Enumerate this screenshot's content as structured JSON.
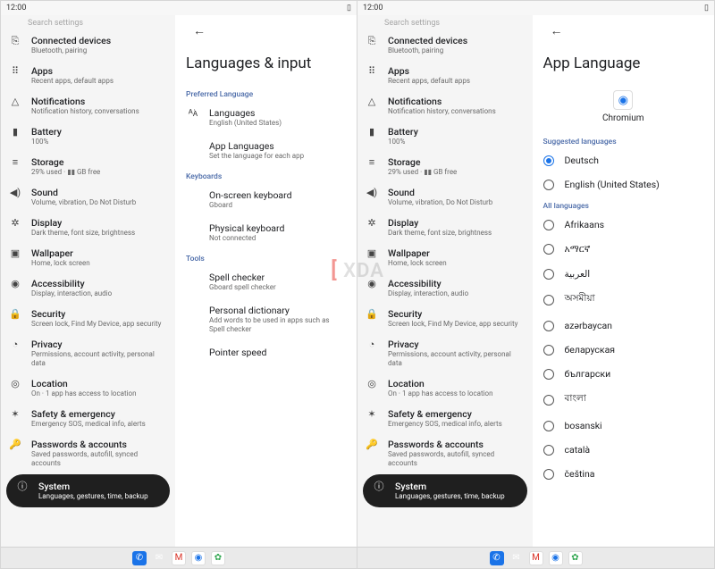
{
  "status": {
    "time": "12:00",
    "battery_glyph": "▯"
  },
  "sidebar": {
    "search_stub": "Search settings",
    "items": [
      {
        "icon": "⎘",
        "title": "Connected devices",
        "sub": "Bluetooth, pairing"
      },
      {
        "icon": "⠿",
        "title": "Apps",
        "sub": "Recent apps, default apps"
      },
      {
        "icon": "△",
        "title": "Notifications",
        "sub": "Notification history, conversations"
      },
      {
        "icon": "▮",
        "title": "Battery",
        "sub": "100%"
      },
      {
        "icon": "≡",
        "title": "Storage",
        "sub": "29% used · ▮▮ GB free"
      },
      {
        "icon": "◀)",
        "title": "Sound",
        "sub": "Volume, vibration, Do Not Disturb"
      },
      {
        "icon": "✲",
        "title": "Display",
        "sub": "Dark theme, font size, brightness"
      },
      {
        "icon": "▣",
        "title": "Wallpaper",
        "sub": "Home, lock screen"
      },
      {
        "icon": "◉",
        "title": "Accessibility",
        "sub": "Display, interaction, audio"
      },
      {
        "icon": "🔒",
        "title": "Security",
        "sub": "Screen lock, Find My Device, app security"
      },
      {
        "icon": "◔",
        "title": "Privacy",
        "sub": "Permissions, account activity, personal data"
      },
      {
        "icon": "◎",
        "title": "Location",
        "sub": "On · 1 app has access to location"
      },
      {
        "icon": "✶",
        "title": "Safety & emergency",
        "sub": "Emergency SOS, medical info, alerts"
      },
      {
        "icon": "🔑",
        "title": "Passwords & accounts",
        "sub": "Saved passwords, autofill, synced accounts"
      },
      {
        "icon": "ⓘ",
        "title": "System",
        "sub": "Languages, gestures, time, backup",
        "active": true
      }
    ]
  },
  "left_pane": {
    "title": "Languages & input",
    "sections": [
      {
        "header": "Preferred Language",
        "rows": [
          {
            "icon": "ᴬ͘ᴀ",
            "title": "Languages",
            "sub": "English (United States)"
          },
          {
            "title": "App Languages",
            "sub": "Set the language for each app"
          }
        ]
      },
      {
        "header": "Keyboards",
        "rows": [
          {
            "title": "On-screen keyboard",
            "sub": "Gboard"
          },
          {
            "title": "Physical keyboard",
            "sub": "Not connected"
          }
        ]
      },
      {
        "header": "Tools",
        "rows": [
          {
            "title": "Spell checker",
            "sub": "Gboard spell checker"
          },
          {
            "title": "Personal dictionary",
            "sub": "Add words to be used in apps such as Spell checker"
          },
          {
            "title": "Pointer speed",
            "sub": ""
          }
        ]
      }
    ]
  },
  "right_pane": {
    "title": "App Language",
    "app": {
      "name": "Chromium",
      "glyph": "◉"
    },
    "suggested_header": "Suggested languages",
    "suggested": [
      {
        "label": "Deutsch",
        "checked": true
      },
      {
        "label": "English (United States)",
        "checked": false
      }
    ],
    "all_header": "All languages",
    "all": [
      "Afrikaans",
      "አማርኛ",
      "العربية",
      "অসমীয়া",
      "azərbaycan",
      "беларуская",
      "български",
      "বাংলা",
      "bosanski",
      "català",
      "čeština"
    ]
  },
  "taskbar": {
    "icons": [
      {
        "name": "phone",
        "glyph": "✆"
      },
      {
        "name": "messages",
        "glyph": "✉"
      },
      {
        "name": "gmail",
        "glyph": "M"
      },
      {
        "name": "chrome",
        "glyph": "◉"
      },
      {
        "name": "photos",
        "glyph": "✿"
      }
    ]
  },
  "watermark": {
    "lb": "[",
    "text": " XDA",
    "rb": "]"
  }
}
